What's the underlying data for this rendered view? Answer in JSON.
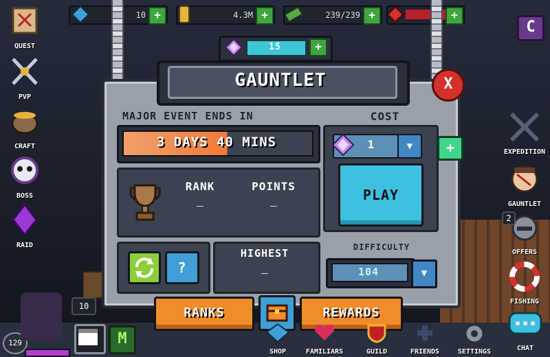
{
  "top_bar": {
    "gems_value": "10",
    "gold_value": "4.3M",
    "energy_value": "239/239",
    "tickets_value": ""
  },
  "left_sidebar": {
    "items": [
      {
        "label": "QUEST"
      },
      {
        "label": "PVP"
      },
      {
        "label": "CRAFT"
      },
      {
        "label": "BOSS"
      },
      {
        "label": "RAID"
      }
    ]
  },
  "right_sidebar": {
    "items": [
      {
        "label": "EXPEDITION"
      },
      {
        "label": "GAUNTLET"
      },
      {
        "label": "OFFERS",
        "badge": "2"
      },
      {
        "label": "FISHING"
      }
    ],
    "chat_label": "CHAT"
  },
  "modal": {
    "gem_counter": "15",
    "title": "GAUNTLET",
    "event_label": "MAJOR EVENT ENDS IN",
    "timer": "3 DAYS 40 MINS",
    "cost_label": "COST",
    "cost_value": "1",
    "play_label": "PLAY",
    "rank_label": "RANK",
    "rank_value": "–",
    "points_label": "POINTS",
    "points_value": "–",
    "help_label": "?",
    "highest_label": "HIGHEST",
    "highest_value": "–",
    "difficulty_label": "DIFFICULTY",
    "difficulty_value": "104",
    "ranks_button": "RANKS",
    "rewards_button": "REWARDS",
    "close_label": "X"
  },
  "player": {
    "level": "129",
    "stack_count": "10"
  },
  "bottom_nav": {
    "items": [
      {
        "label": "SHOP"
      },
      {
        "label": "FAMILIARS"
      },
      {
        "label": "GUILD"
      },
      {
        "label": "FRIENDS"
      },
      {
        "label": "SETTINGS"
      }
    ],
    "mode_letter": "M"
  },
  "colors": {
    "accent_orange": "#f08c2a",
    "play_blue": "#3fc0e0",
    "close_red": "#d6302a",
    "plus_green": "#3fd68a"
  }
}
